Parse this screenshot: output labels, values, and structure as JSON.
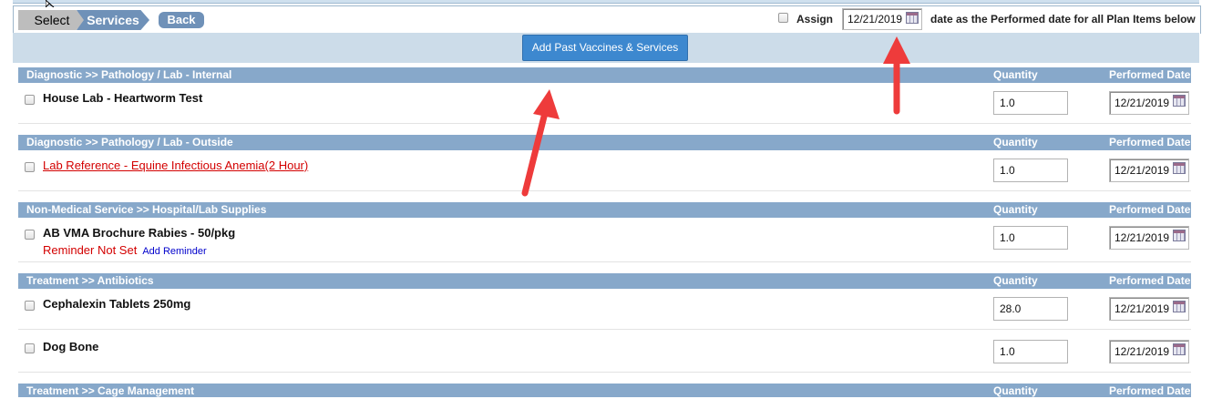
{
  "toolbar": {
    "steps": [
      "Select",
      "Services"
    ],
    "back_label": "Back",
    "assign_label": "Assign",
    "assign_date": "12/21/2019",
    "assign_tail": "date as the Performed date for all Plan Items below"
  },
  "add_past_label": "Add Past Vaccines & Services",
  "columns": {
    "quantity": "Quantity",
    "performed_date": "Performed Date"
  },
  "groups": [
    {
      "title": "Diagnostic >> Pathology / Lab - Internal",
      "items": [
        {
          "name": "House Lab - Heartworm Test",
          "quantity": "1.0",
          "date": "12/21/2019"
        }
      ]
    },
    {
      "title": "Diagnostic >> Pathology / Lab - Outside",
      "items": [
        {
          "name": "Lab Reference - Equine Infectious Anemia(2 Hour)",
          "quantity": "1.0",
          "date": "12/21/2019"
        }
      ]
    },
    {
      "title": "Non-Medical Service >> Hospital/Lab Supplies",
      "items": [
        {
          "name": "AB VMA Brochure Rabies - 50/pkg",
          "reminder_status": "Reminder Not Set",
          "reminder_link": "Add Reminder",
          "quantity": "1.0",
          "date": "12/21/2019"
        }
      ]
    },
    {
      "title": "Treatment >> Antibiotics",
      "items": [
        {
          "name": "Cephalexin Tablets 250mg",
          "quantity": "28.0",
          "date": "12/21/2019"
        },
        {
          "name": "Dog Bone",
          "quantity": "1.0",
          "date": "12/21/2019"
        }
      ]
    },
    {
      "title": "Treatment >> Cage Management",
      "items": []
    }
  ],
  "colors": {
    "header_band": "#87a8ca",
    "accent_button": "#3d88cf",
    "annotation_arrow": "#ee3b3b",
    "link_red": "#d30000"
  }
}
